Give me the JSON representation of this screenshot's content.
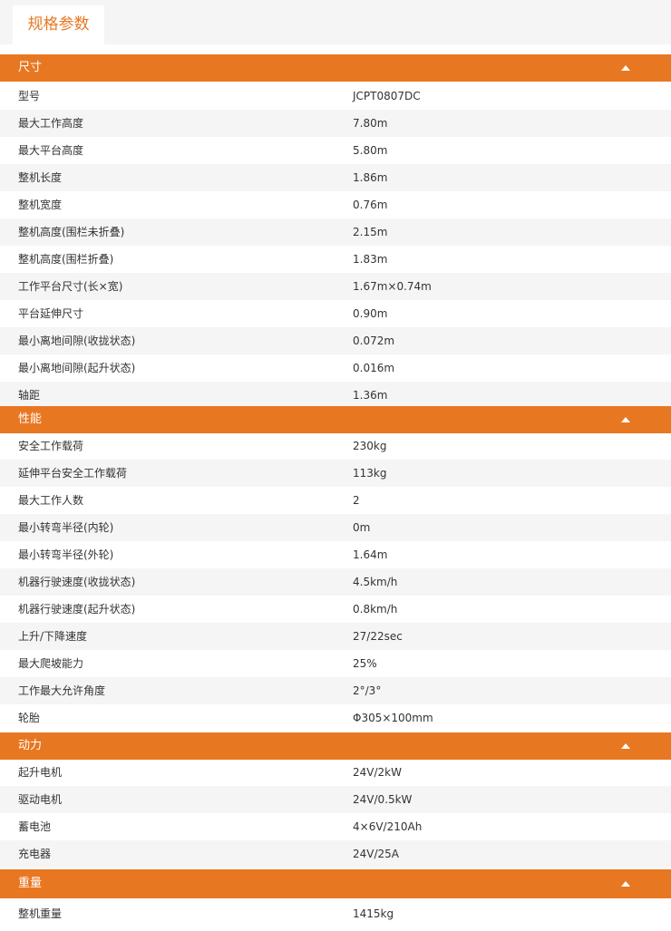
{
  "tab": {
    "label": "规格参数"
  },
  "colors": {
    "accent": "#e87722",
    "stripe": "#f5f5f5",
    "text": "#333333"
  },
  "sections": [
    {
      "title": "尺寸",
      "rows": [
        {
          "key": "型号",
          "value": "JCPT0807DC"
        },
        {
          "key": "最大工作高度",
          "value": "7.80m"
        },
        {
          "key": "最大平台高度",
          "value": "5.80m"
        },
        {
          "key": "整机长度",
          "value": "1.86m"
        },
        {
          "key": "整机宽度",
          "value": "0.76m"
        },
        {
          "key": "整机高度(围栏未折叠)",
          "value": "2.15m"
        },
        {
          "key": "整机高度(围栏折叠)",
          "value": "1.83m"
        },
        {
          "key": "工作平台尺寸(长×宽)",
          "value": "1.67m×0.74m"
        },
        {
          "key": "平台延伸尺寸",
          "value": "0.90m"
        },
        {
          "key": "最小离地间隙(收拢状态)",
          "value": "0.072m"
        },
        {
          "key": "最小离地间隙(起升状态)",
          "value": "0.016m"
        },
        {
          "key": "轴距",
          "value": "1.36m"
        }
      ]
    },
    {
      "title": "性能",
      "rows": [
        {
          "key": "安全工作载荷",
          "value": "230kg"
        },
        {
          "key": "延伸平台安全工作载荷",
          "value": "113kg"
        },
        {
          "key": "最大工作人数",
          "value": "2"
        },
        {
          "key": "最小转弯半径(内轮)",
          "value": "0m"
        },
        {
          "key": "最小转弯半径(外轮)",
          "value": "1.64m"
        },
        {
          "key": "机器行驶速度(收拢状态)",
          "value": "4.5km/h"
        },
        {
          "key": "机器行驶速度(起升状态)",
          "value": "0.8km/h"
        },
        {
          "key": "上升/下降速度",
          "value": "27/22sec"
        },
        {
          "key": "最大爬坡能力",
          "value": "25%"
        },
        {
          "key": "工作最大允许角度",
          "value": "2°/3°"
        },
        {
          "key": "轮胎",
          "value": "Φ305×100mm"
        }
      ]
    },
    {
      "title": "动力",
      "rows": [
        {
          "key": "起升电机",
          "value": "24V/2kW"
        },
        {
          "key": "驱动电机",
          "value": "24V/0.5kW"
        },
        {
          "key": "蓄电池",
          "value": "4×6V/210Ah"
        },
        {
          "key": "充电器",
          "value": "24V/25A"
        }
      ]
    },
    {
      "title": "重量",
      "rows": [
        {
          "key": "整机重量",
          "value": "1415kg"
        }
      ]
    }
  ]
}
